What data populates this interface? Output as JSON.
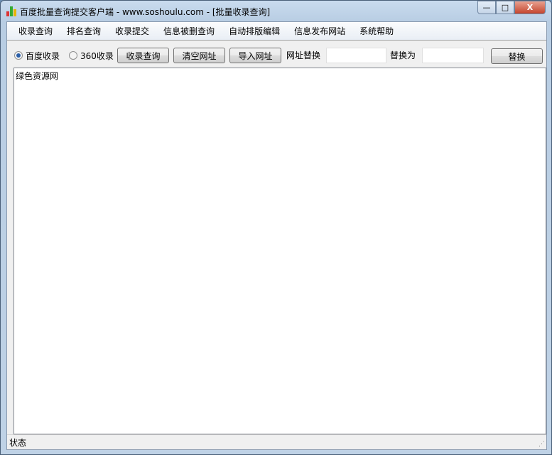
{
  "window": {
    "title": "百度批量查询提交客户端 - www.soshoulu.com - [批量收录查询]",
    "min": "—",
    "max": "□",
    "close": "X"
  },
  "menu": [
    "收录查询",
    "排名查询",
    "收录提交",
    "信息被删查询",
    "自动排版编辑",
    "信息发布网站",
    "系统帮助"
  ],
  "toolbar": {
    "radio_baidu": "百度收录",
    "radio_360": "360收录",
    "query": "收录查询",
    "clear": "清空网址",
    "import": "导入网址",
    "url_replace": "网址替换",
    "replace_with": "替换为",
    "replace": "替换",
    "url_replace_value": "",
    "replace_with_value": ""
  },
  "content": "绿色资源网",
  "status": "状态"
}
